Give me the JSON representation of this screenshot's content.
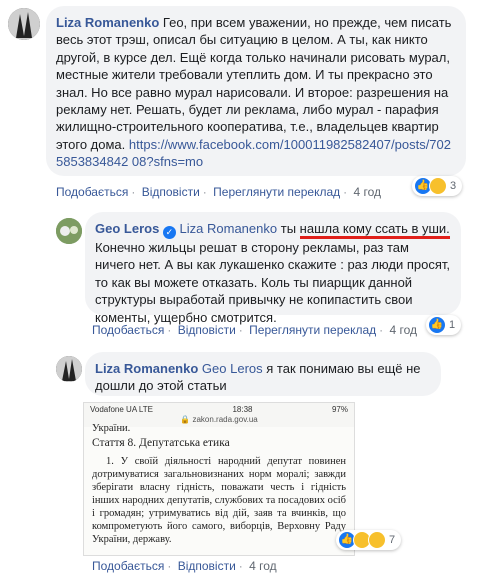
{
  "comments": [
    {
      "author": "Liza Romanenko",
      "body": "Гео, при всем уважении, но прежде, чем писать весь этот трэш, описал бы ситуацию в целом. А ты, как никто другой, в курсе дел. Ещё когда только начинали рисовать мурал, местные жители требовали утеплить дом. И ты прекрасно это знал. Но все равно мурал нарисовали. И второе: разрешения на рекламу нет. Решать, будет ли реклама, либо мурал - парафия жилищно-строительного кооператива, т.е., владельцев квартир этого дома.",
      "link": "https://www.facebook.com/100011982582407/posts/7025853834842 08?sfns=mo",
      "actions": [
        "Подобається",
        "Відповісти",
        "Переглянути переклад"
      ],
      "time": "4 год",
      "reaction_count": "3"
    },
    {
      "author": "Geo Leros",
      "mention": "Liza Romanenko",
      "pre": "ты ",
      "underlined": "нашла кому ссать в уши.",
      "body": "Конечно жильцы решат в сторону рекламы, раз там ничего нет. А вы как лукашенко скажите : раз люди просят, то как вы можете отказать. Коль ты пиарщик данной структуры выработай привычку не копипастить свои коменты, ущербно смотрится.",
      "actions": [
        "Подобається",
        "Відповісти",
        "Переглянути переклад"
      ],
      "time": "4 год",
      "reaction_count": "1"
    },
    {
      "author": "Liza Romanenko",
      "mention": "Geo Leros",
      "body": "я так понимаю вы ещё не дошли до этой статьи",
      "actions": [
        "Подобається",
        "Відповісти"
      ],
      "time": "4 год",
      "reaction_count": "7"
    }
  ],
  "screenshot": {
    "carrier": "Vodafone UA LTE",
    "clock": "18:38",
    "battery": "97%",
    "url": "zakon.rada.gov.ua",
    "cut_text": "України.",
    "article_title": "Стаття 8. Депутатська етика",
    "p1": "1. У своїй діяльності народний депутат повинен дотримуватися загальновизнаних норм моралі; завжди зберігати власну гідність, поважати честь і гідність інших народних депутатів, службових та посадових осіб і громадян; утримуватись від дій, заяв та вчинків, що компрометують його самого, виборців, Верховну Раду України, державу."
  }
}
